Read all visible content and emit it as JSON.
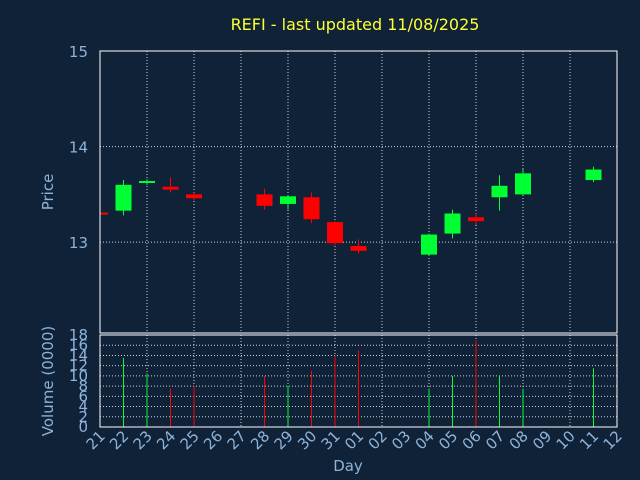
{
  "chart_data": {
    "type": "candlestick",
    "title": "REFI - last updated 11/08/2025",
    "colors": {
      "background": "#0f2238",
      "title": "#ffff33",
      "axis_text": "#8fb3d9",
      "frame": "#ffffff",
      "up": "#00ff33",
      "down": "#ff0000"
    },
    "price_panel": {
      "ylabel": "Price",
      "ylim": [
        12.05,
        15.0
      ],
      "yticks": [
        13,
        14,
        15
      ],
      "grid": true
    },
    "volume_panel": {
      "ylabel": "Volume (0000)",
      "ylim": [
        0,
        18
      ],
      "yticks": [
        0,
        2,
        4,
        6,
        8,
        10,
        12,
        14,
        16,
        18
      ],
      "grid": true
    },
    "xlabel": "Day",
    "x_tick_labels": [
      "21",
      "22",
      "23",
      "24",
      "25",
      "26",
      "27",
      "28",
      "29",
      "30",
      "31",
      "01",
      "02",
      "03",
      "04",
      "05",
      "06",
      "07",
      "08",
      "09",
      "10",
      "11",
      "12"
    ],
    "candles": [
      {
        "day": "21",
        "open": 13.31,
        "close": 13.3,
        "high": 13.31,
        "low": 13.3,
        "volume": 0
      },
      {
        "day": "22",
        "open": 13.33,
        "close": 13.6,
        "high": 13.65,
        "low": 13.28,
        "volume": 13.5
      },
      {
        "day": "23",
        "open": 13.62,
        "close": 13.64,
        "high": 13.66,
        "low": 13.6,
        "volume": 10.5
      },
      {
        "day": "24",
        "open": 13.58,
        "close": 13.55,
        "high": 13.68,
        "low": 13.52,
        "volume": 7.5
      },
      {
        "day": "25",
        "open": 13.5,
        "close": 13.46,
        "high": 13.52,
        "low": 13.44,
        "volume": 8.0
      },
      {
        "day": "28",
        "open": 13.5,
        "close": 13.38,
        "high": 13.56,
        "low": 13.34,
        "volume": 10.0
      },
      {
        "day": "29",
        "open": 13.4,
        "close": 13.48,
        "high": 13.49,
        "low": 13.34,
        "volume": 8.0
      },
      {
        "day": "30",
        "open": 13.47,
        "close": 13.24,
        "high": 13.52,
        "low": 13.2,
        "volume": 11.0
      },
      {
        "day": "31",
        "open": 13.21,
        "close": 12.99,
        "high": 13.22,
        "low": 12.97,
        "volume": 14.0
      },
      {
        "day": "01",
        "open": 12.96,
        "close": 12.91,
        "high": 13.03,
        "low": 12.88,
        "volume": 15.0
      },
      {
        "day": "04",
        "open": 12.87,
        "close": 13.08,
        "high": 13.09,
        "low": 12.86,
        "volume": 7.5
      },
      {
        "day": "05",
        "open": 13.09,
        "close": 13.3,
        "high": 13.34,
        "low": 13.04,
        "volume": 10.0
      },
      {
        "day": "06",
        "open": 13.26,
        "close": 13.22,
        "high": 13.3,
        "low": 13.18,
        "volume": 17.0
      },
      {
        "day": "07",
        "open": 13.47,
        "close": 13.59,
        "high": 13.7,
        "low": 13.33,
        "volume": 10.0
      },
      {
        "day": "08",
        "open": 13.5,
        "close": 13.72,
        "high": 13.77,
        "low": 13.49,
        "volume": 7.5
      },
      {
        "day": "11",
        "open": 13.65,
        "close": 13.76,
        "high": 13.79,
        "low": 13.63,
        "volume": 11.5
      }
    ]
  }
}
